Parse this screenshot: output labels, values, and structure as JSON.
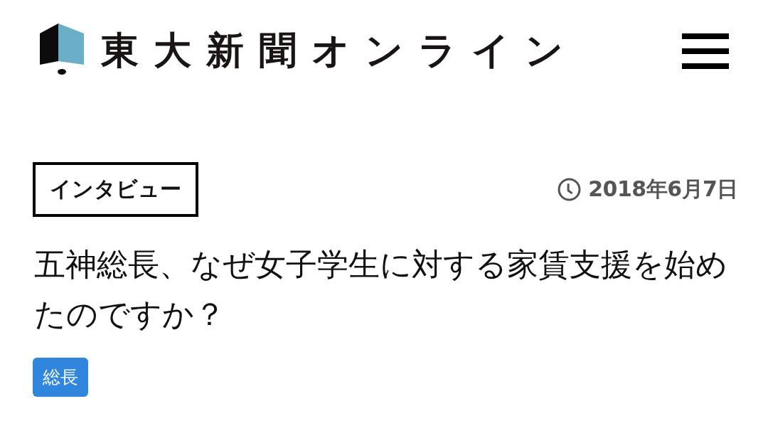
{
  "header": {
    "site_title": "東大新聞オンライン"
  },
  "article": {
    "category": "インタビュー",
    "date": "2018年6月7日",
    "title": "五神総長、なぜ女子学生に対する家賃支援を始めたのですか？",
    "tags": [
      {
        "label": "総長"
      }
    ]
  }
}
